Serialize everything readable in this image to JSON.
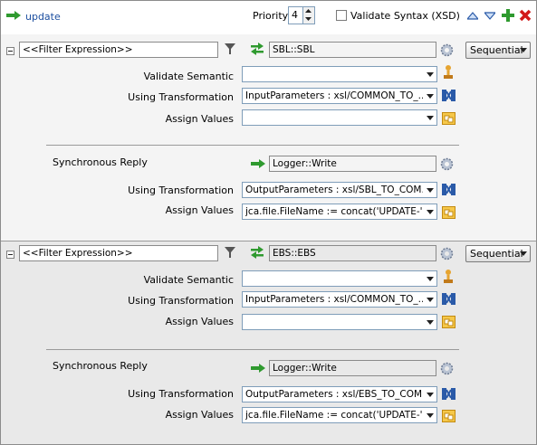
{
  "header": {
    "operation_label": "update",
    "priority_label": "Priority",
    "priority_value": "4",
    "validate_syntax_label": "Validate Syntax (XSD)",
    "validate_syntax_checked": false
  },
  "labels": {
    "validate_semantic": "Validate Semantic",
    "using_transformation": "Using Transformation",
    "assign_values": "Assign Values",
    "synchronous_reply": "Synchronous Reply"
  },
  "rules": [
    {
      "filter_expression": "<<Filter Expression>>",
      "target_service": "SBL::SBL",
      "execution_mode": "Sequential",
      "validate_semantic_value": "",
      "request_transformation": "InputParameters : xsl/COMMON_TO_...",
      "request_assign_values": "",
      "reply_target": "Logger::Write",
      "reply_transformation": "OutputParameters : xsl/SBL_TO_COM...",
      "reply_assign_values": "jca.file.FileName := concat('UPDATE-',..."
    },
    {
      "filter_expression": "<<Filter Expression>>",
      "target_service": "EBS::EBS",
      "execution_mode": "Sequential",
      "validate_semantic_value": "",
      "request_transformation": "InputParameters : xsl/COMMON_TO_...",
      "request_assign_values": "",
      "reply_target": "Logger::Write",
      "reply_transformation": "OutputParameters : xsl/EBS_TO_COM...",
      "reply_assign_values": "jca.file.FileName := concat('UPDATE-',..."
    }
  ],
  "colors": {
    "arrow_green": "#2f9a2f",
    "link_blue": "#1d4fa0",
    "delete_red": "#d21a1a",
    "xsl_blue": "#2a5aa8",
    "assign_orange": "#e8a520"
  }
}
